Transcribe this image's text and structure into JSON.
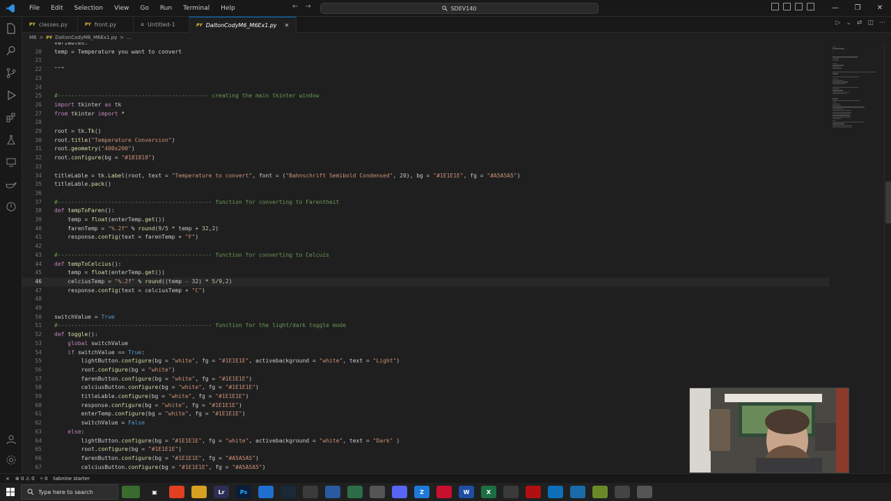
{
  "titlebar": {
    "menus": [
      "File",
      "Edit",
      "Selection",
      "View",
      "Go",
      "Run",
      "Terminal",
      "Help"
    ],
    "search_text": "SDEV140",
    "nav_back": "←",
    "nav_forward": "→",
    "win_min": "—",
    "win_max": "❐",
    "win_close": "✕"
  },
  "tabs": [
    {
      "label": "classes.py",
      "prefix": "PY"
    },
    {
      "label": "front.py",
      "prefix": "PY"
    },
    {
      "label": "Untitled-1",
      "prefix": "≡"
    },
    {
      "label": "DaltonCodyM6_M6Ex1.py",
      "prefix": "PY",
      "close": "✕"
    }
  ],
  "breadcrumb": {
    "folder": "M6",
    "sep": ">",
    "file": "DaltonCodyM6_M6Ex1.py",
    "sep2": ">",
    "more": "..."
  },
  "code_lines": [
    {
      "n": "",
      "t": "variables:"
    },
    {
      "n": "20",
      "t": "temp = Temperature you want to convert"
    },
    {
      "n": "21",
      "t": ""
    },
    {
      "n": "22",
      "t": "\"\"\""
    },
    {
      "n": "23",
      "t": ""
    },
    {
      "n": "24",
      "t": ""
    },
    {
      "n": "25",
      "t": "#--------------------------------------------- creating the main tkinter window"
    },
    {
      "n": "26",
      "t": "import tkinter as tk"
    },
    {
      "n": "27",
      "t": "from tkinter import *"
    },
    {
      "n": "28",
      "t": ""
    },
    {
      "n": "29",
      "t": "root = tk.Tk()"
    },
    {
      "n": "30",
      "t": "root.title(\"Temperature Conversion\")"
    },
    {
      "n": "31",
      "t": "root.geometry(\"400x200\")"
    },
    {
      "n": "32",
      "t": "root.configure(bg = \"#181818\")"
    },
    {
      "n": "33",
      "t": ""
    },
    {
      "n": "34",
      "t": "titleLable = tk.Label(root, text = \"Temperature to convert\", font = (\"Bahnschrift Semibold Condensed\", 20), bg = \"#1E1E1E\", fg = \"#A5A5A5\")"
    },
    {
      "n": "35",
      "t": "titleLable.pack()"
    },
    {
      "n": "36",
      "t": ""
    },
    {
      "n": "37",
      "t": "#---------------------------------------------- function for converting to Farentheit"
    },
    {
      "n": "38",
      "t": "def tempToFaren():"
    },
    {
      "n": "39",
      "t": "    temp = float(enterTemp.get())"
    },
    {
      "n": "40",
      "t": "    farenTemp = \"%.2f\" % round(9/5 * temp + 32,2)"
    },
    {
      "n": "41",
      "t": "    response.config(text = farenTemp + \"F\")"
    },
    {
      "n": "42",
      "t": ""
    },
    {
      "n": "43",
      "t": "#---------------------------------------------- function for converting to Celcuis"
    },
    {
      "n": "44",
      "t": "def tempToCelcius():"
    },
    {
      "n": "45",
      "t": "    temp = float(enterTemp.get())"
    },
    {
      "n": "46",
      "t": "    celciusTemp = \"%.2f\" % round((temp - 32) * 5/9,2)"
    },
    {
      "n": "47",
      "t": "    response.config(text = celciusTemp + \"C\")"
    },
    {
      "n": "48",
      "t": ""
    },
    {
      "n": "49",
      "t": ""
    },
    {
      "n": "50",
      "t": "switchValue = True"
    },
    {
      "n": "51",
      "t": "#---------------------------------------------- function for the light/dark toggle mode"
    },
    {
      "n": "52",
      "t": "def toggle():"
    },
    {
      "n": "53",
      "t": "    global switchValue"
    },
    {
      "n": "54",
      "t": "    if switchValue == True:"
    },
    {
      "n": "55",
      "t": "        lightButton.configure(bg = \"white\", fg = \"#1E1E1E\", activebackground = \"white\", text = \"Light\")"
    },
    {
      "n": "56",
      "t": "        root.configure(bg = \"white\")"
    },
    {
      "n": "57",
      "t": "        farenButton.configure(bg = \"white\", fg = \"#1E1E1E\")"
    },
    {
      "n": "58",
      "t": "        celciusButton.configure(bg = \"white\", fg = \"#1E1E1E\")"
    },
    {
      "n": "59",
      "t": "        titleLable.configure(bg = \"white\", fg = \"#1E1E1E\")"
    },
    {
      "n": "60",
      "t": "        response.configure(bg = \"white\", fg = \"#1E1E1E\")"
    },
    {
      "n": "61",
      "t": "        enterTemp.configure(bg = \"white\", fg = \"#1E1E1E\")"
    },
    {
      "n": "62",
      "t": "        switchValue = False"
    },
    {
      "n": "63",
      "t": "    else:"
    },
    {
      "n": "64",
      "t": "        lightButton.configure(bg = \"#1E1E1E\", fg = \"white\", activebackground = \"white\", text = \"Dark\" )"
    },
    {
      "n": "65",
      "t": "        root.configure(bg = \"#1E1E1E\")"
    },
    {
      "n": "66",
      "t": "        farenButton.configure(bg = \"#1E1E1E\", fg = \"#A5A5A5\")"
    },
    {
      "n": "67",
      "t": "        celciusButton.configure(bg = \"#1E1E1E\", fg = \"#A5A5A5\")"
    }
  ],
  "current_line": "46",
  "statusbar": {
    "errors": "⊗ 0 ⚠ 0",
    "ports": "⑂ 0",
    "extension": "tabnine starter"
  },
  "taskbar": {
    "search_placeholder": "Type here to search"
  },
  "colors": {
    "accent": "#0078d4",
    "editor_bg": "#1f1f1f",
    "chrome_bg": "#181818"
  }
}
